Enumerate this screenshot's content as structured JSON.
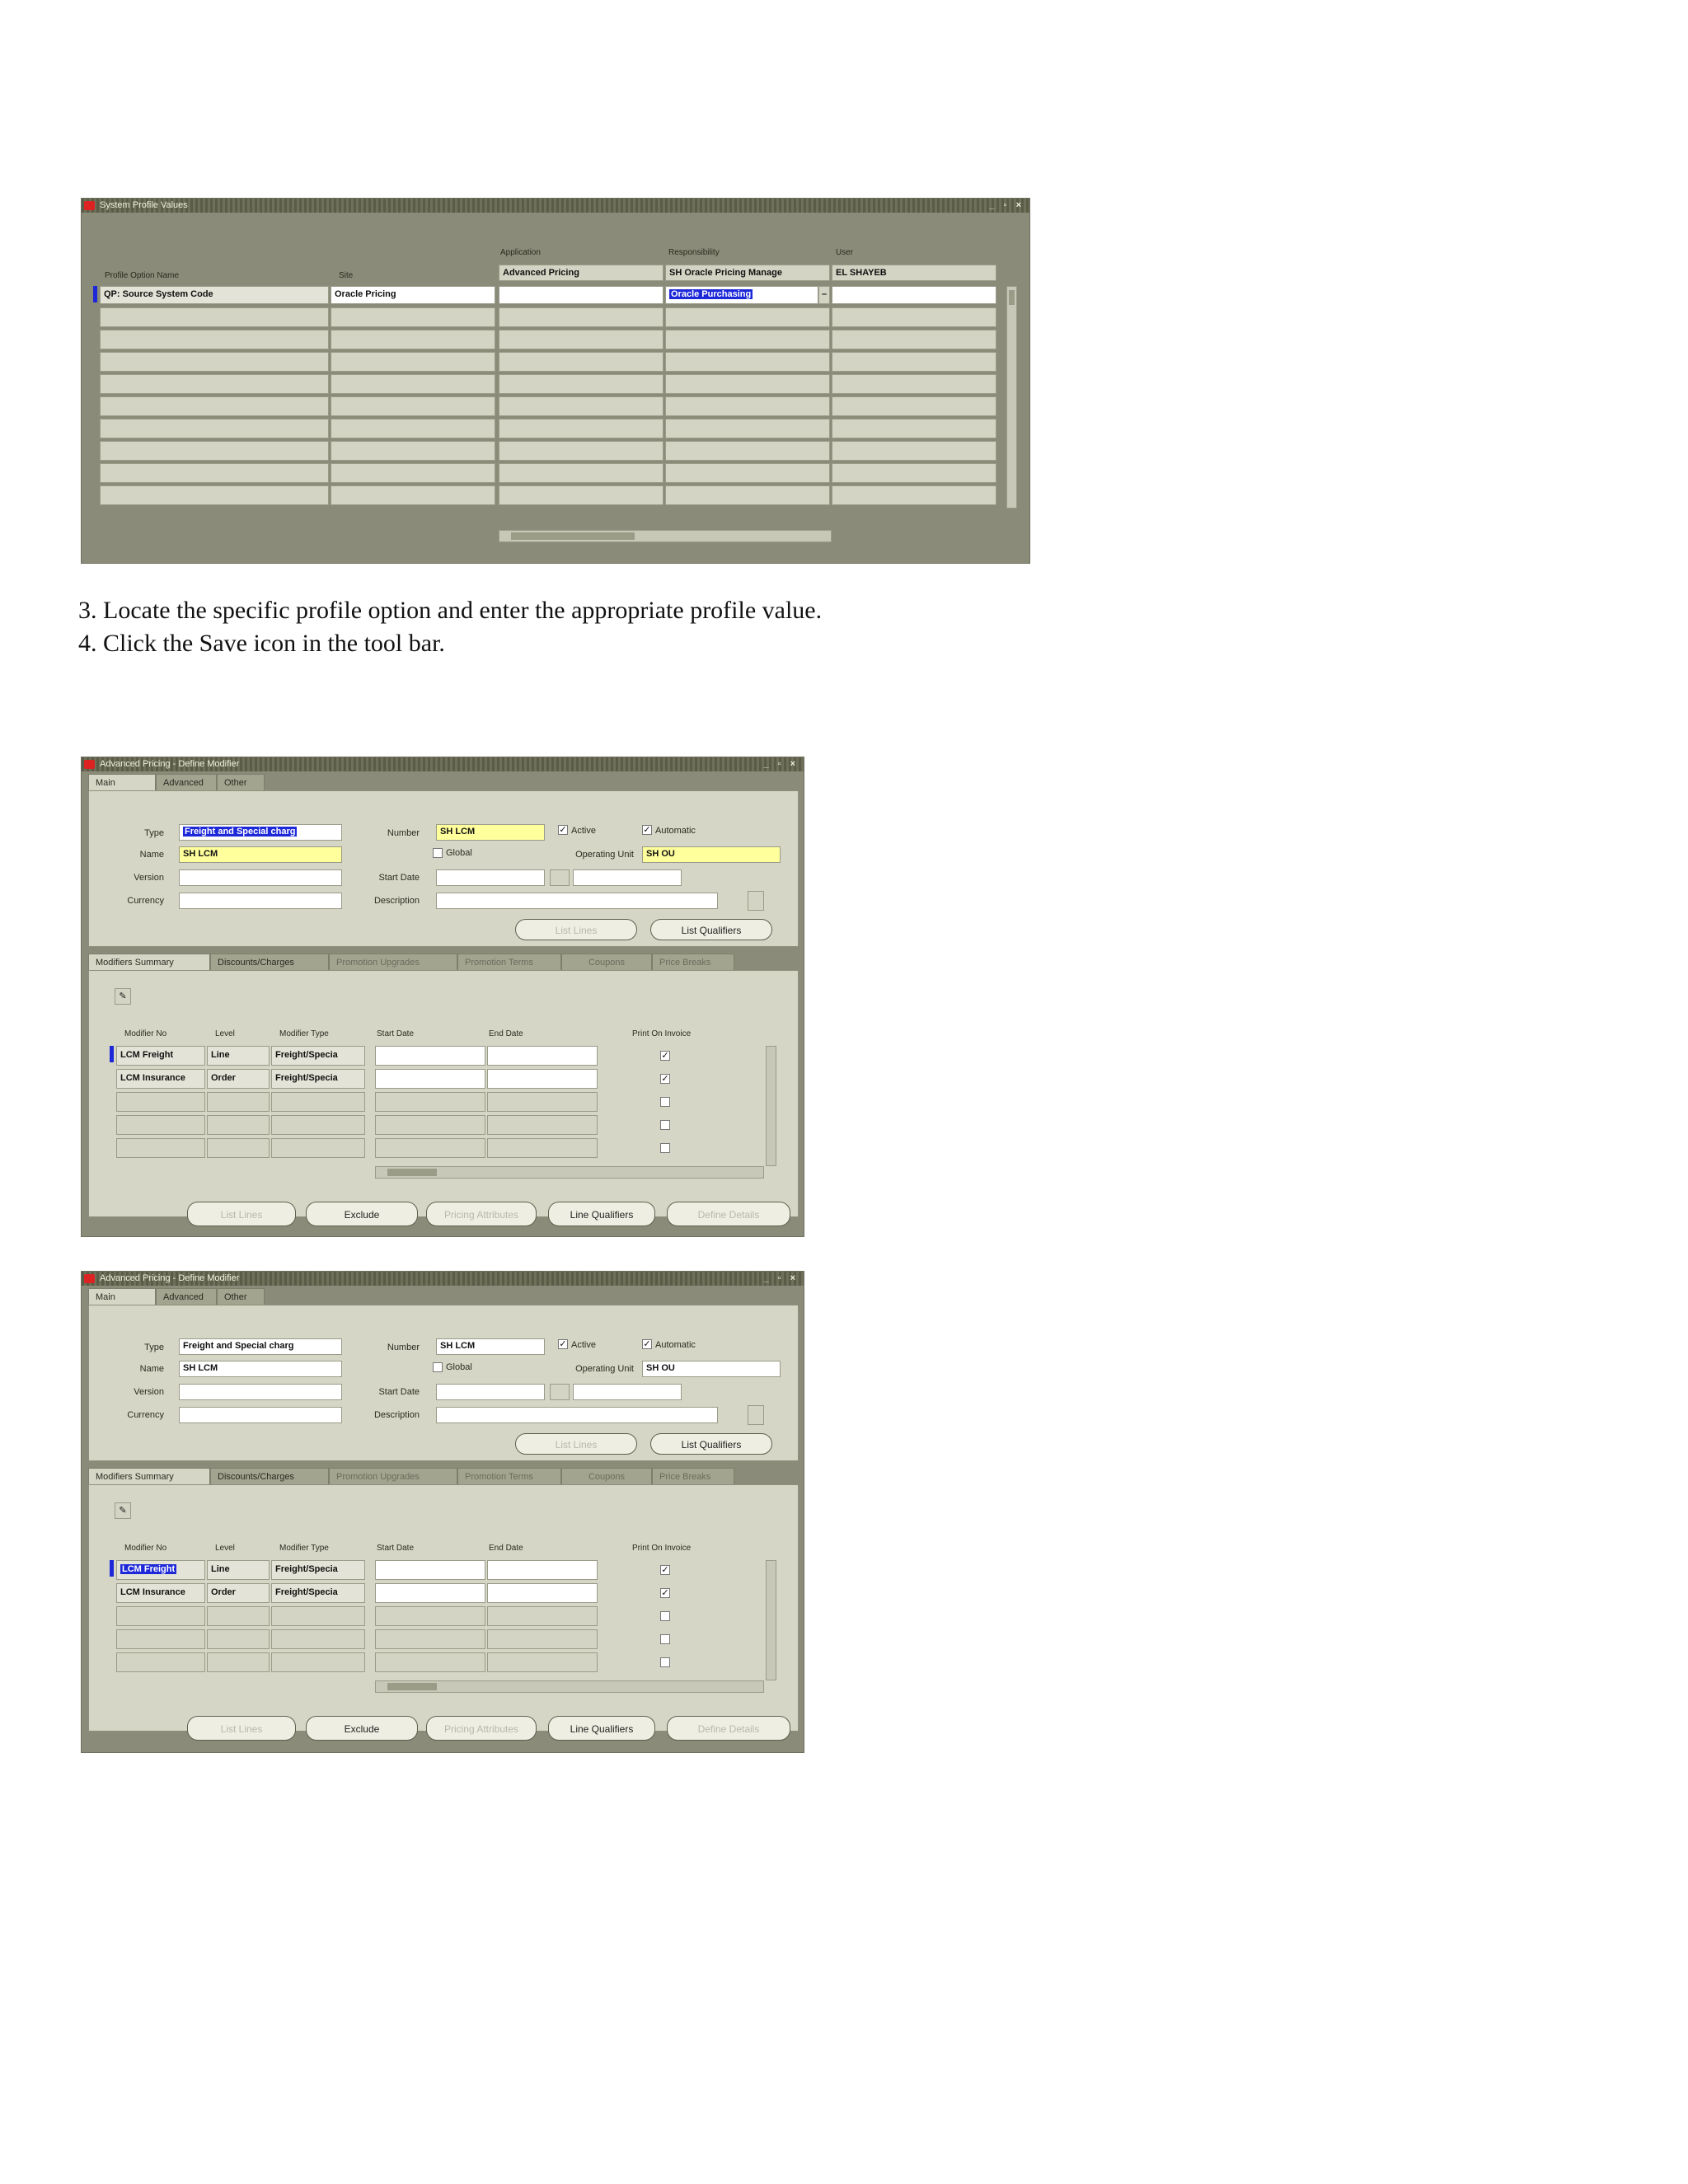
{
  "instructions": [
    "3. Locate the specific profile option and enter the appropriate profile value.",
    "4. Click  the Save icon in the tool bar."
  ],
  "profile_window": {
    "title": "System Profile Values",
    "window_controls": "_ ▫ ×",
    "group_labels": {
      "application": "Application",
      "responsibility": "Responsibility",
      "user": "User"
    },
    "columns": [
      "Profile Option Name",
      "Site",
      "Advanced Pricing",
      "SH Oracle Pricing Manage",
      "EL SHAYEB"
    ],
    "row": {
      "profile_option_name": "QP: Source System Code",
      "site": "Oracle Pricing",
      "application": "",
      "responsibility": "Oracle Purchasing",
      "user": ""
    }
  },
  "modifier_windows": [
    {
      "title": "Advanced Pricing - Define Modifier",
      "window_controls": "_ ▫ ×",
      "tabs": [
        "Main",
        "Advanced",
        "Other"
      ],
      "labels": {
        "type": "Type",
        "name": "Name",
        "version": "Version",
        "currency": "Currency",
        "number": "Number",
        "start_date": "Start Date",
        "description": "Description",
        "operating_unit": "Operating Unit",
        "active": "Active",
        "automatic": "Automatic",
        "global": "Global"
      },
      "values": {
        "type": "Freight and Special charg",
        "name": "SH LCM",
        "number": "SH LCM",
        "operating_unit": "SH OU",
        "active": true,
        "automatic": true,
        "global": false
      },
      "header_buttons": [
        "List Lines",
        "List Qualifiers"
      ],
      "sub_tabs": [
        "Modifiers Summary",
        "Discounts/Charges",
        "Promotion Upgrades",
        "Promotion Terms",
        "Coupons",
        "Price Breaks"
      ],
      "table_columns": [
        "Modifier No",
        "Level",
        "Modifier Type",
        "Start Date",
        "End Date",
        "Print On Invoice"
      ],
      "rows": [
        {
          "modifier_no": "LCM Freight",
          "level": "Line",
          "modifier_type": "Freight/Specia",
          "print": true
        },
        {
          "modifier_no": "LCM Insurance",
          "level": "Order",
          "modifier_type": "Freight/Specia",
          "print": true
        },
        {
          "modifier_no": "",
          "level": "",
          "modifier_type": "",
          "print": false
        },
        {
          "modifier_no": "",
          "level": "",
          "modifier_type": "",
          "print": false
        },
        {
          "modifier_no": "",
          "level": "",
          "modifier_type": "",
          "print": false
        }
      ],
      "footer_buttons": [
        "List Lines",
        "Exclude",
        "Pricing Attributes",
        "Line Qualifiers",
        "Define Details"
      ]
    },
    {
      "title": "Advanced Pricing - Define Modifier",
      "window_controls": "_ ▫ ×",
      "tabs": [
        "Main",
        "Advanced",
        "Other"
      ],
      "labels": {
        "type": "Type",
        "name": "Name",
        "version": "Version",
        "currency": "Currency",
        "number": "Number",
        "start_date": "Start Date",
        "description": "Description",
        "operating_unit": "Operating Unit",
        "active": "Active",
        "automatic": "Automatic",
        "global": "Global"
      },
      "values": {
        "type": "Freight and Special charg",
        "name": "SH LCM",
        "number": "SH LCM",
        "operating_unit": "SH OU",
        "active": true,
        "automatic": true,
        "global": false
      },
      "header_buttons": [
        "List Lines",
        "List Qualifiers"
      ],
      "sub_tabs": [
        "Modifiers Summary",
        "Discounts/Charges",
        "Promotion Upgrades",
        "Promotion Terms",
        "Coupons",
        "Price Breaks"
      ],
      "table_columns": [
        "Modifier No",
        "Level",
        "Modifier Type",
        "Start Date",
        "End Date",
        "Print On Invoice"
      ],
      "rows": [
        {
          "modifier_no": "LCM Freight",
          "level": "Line",
          "modifier_type": "Freight/Specia",
          "print": true
        },
        {
          "modifier_no": "LCM Insurance",
          "level": "Order",
          "modifier_type": "Freight/Specia",
          "print": true
        },
        {
          "modifier_no": "",
          "level": "",
          "modifier_type": "",
          "print": false
        },
        {
          "modifier_no": "",
          "level": "",
          "modifier_type": "",
          "print": false
        },
        {
          "modifier_no": "",
          "level": "",
          "modifier_type": "",
          "print": false
        }
      ],
      "footer_buttons": [
        "List Lines",
        "Exclude",
        "Pricing Attributes",
        "Line Qualifiers",
        "Define Details"
      ]
    }
  ]
}
